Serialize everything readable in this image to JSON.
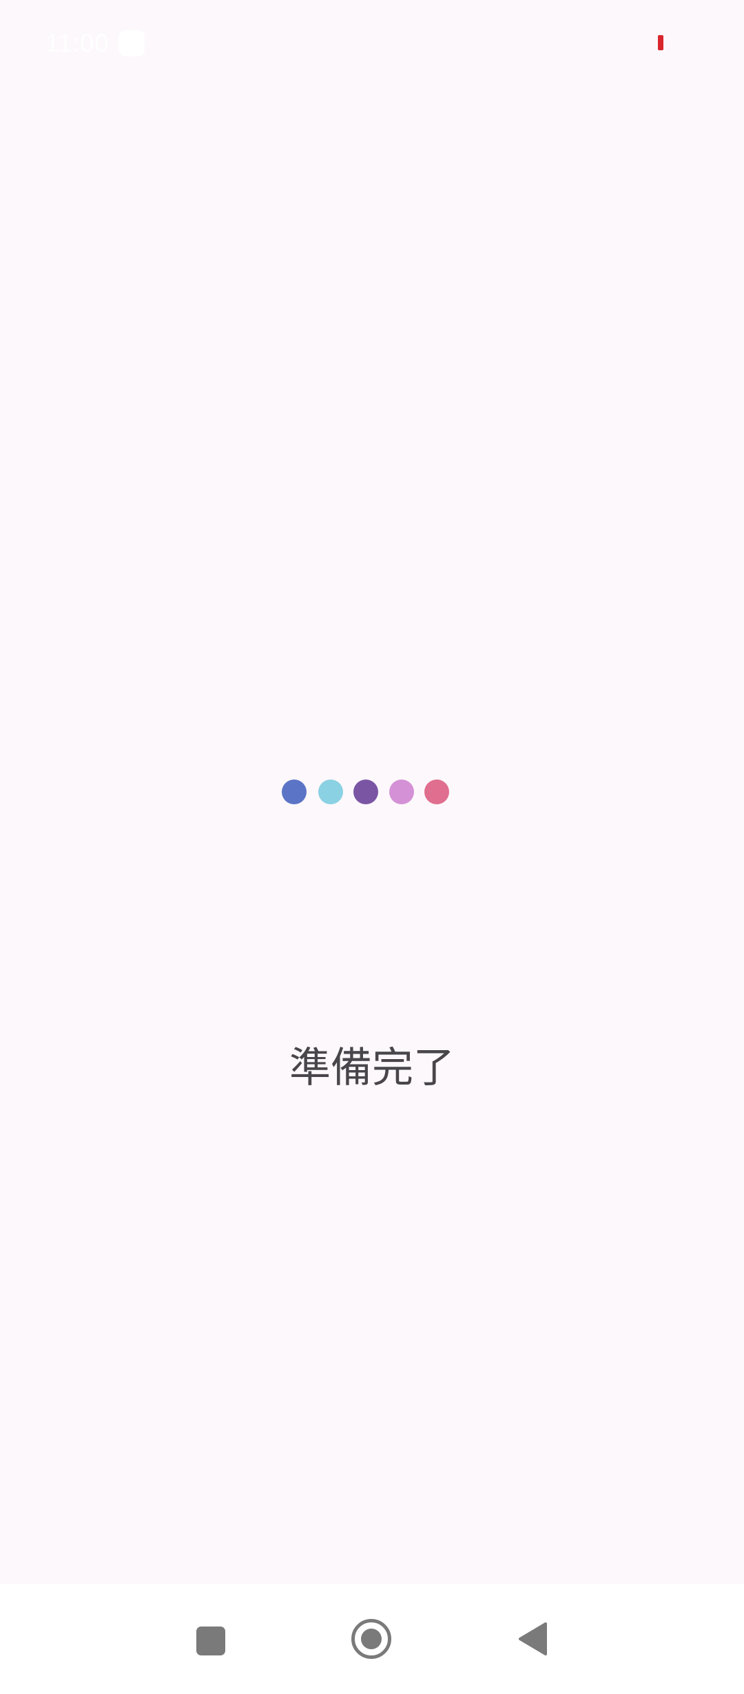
{
  "status_bar": {
    "time": "11:00",
    "battery_color": "#d8262c"
  },
  "loading": {
    "dots": [
      {
        "color": "#5b74c6"
      },
      {
        "color": "#8ad1e3"
      },
      {
        "color": "#7a55a4"
      },
      {
        "color": "#d491d6"
      },
      {
        "color": "#df6e8f"
      }
    ]
  },
  "main": {
    "status_text": "準備完了"
  },
  "nav_bar": {
    "recents_icon": "square-icon",
    "home_icon": "circle-home-icon",
    "back_icon": "triangle-back-icon"
  }
}
